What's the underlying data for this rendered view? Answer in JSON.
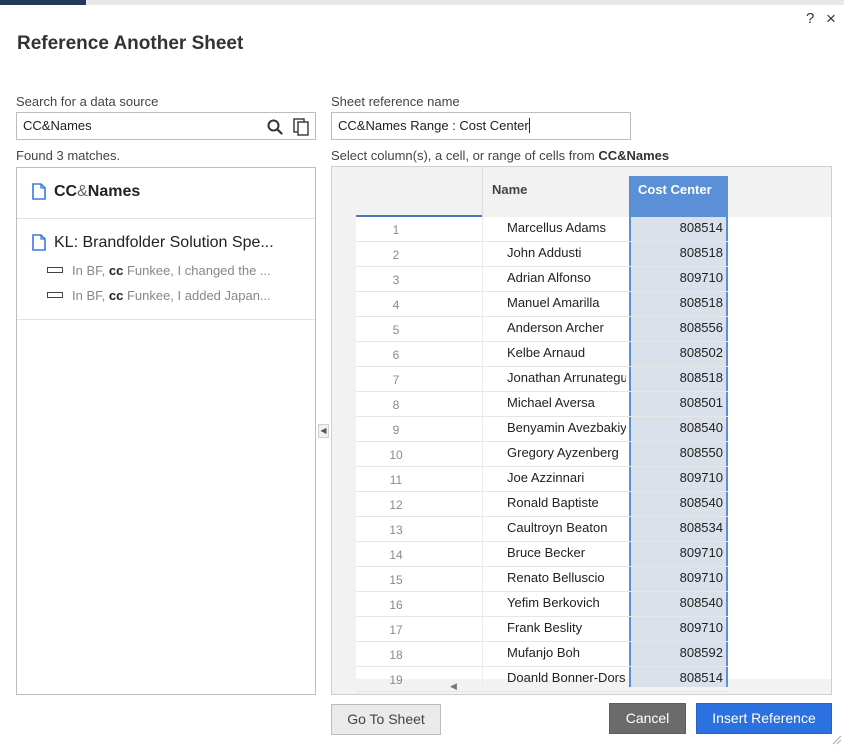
{
  "dialog": {
    "title": "Reference Another Sheet",
    "help_icon": "?",
    "close_icon": "×"
  },
  "search": {
    "label": "Search for a data source",
    "value": "CC&Names",
    "found_text": "Found 3 matches."
  },
  "reference": {
    "label": "Sheet reference name",
    "value": "CC&Names Range : Cost Center",
    "select_prefix": "Select column(s), a cell, or range of cells from ",
    "select_sheet": "CC&Names"
  },
  "results": [
    {
      "name_part1": "CC",
      "name_part2": "&",
      "name_part3": "Names",
      "comments": []
    },
    {
      "name": "KL: Brandfolder Solution Spe...",
      "comments": [
        {
          "prefix": "In BF, ",
          "highlight": "cc",
          "suffix": " Funkee, I changed the ..."
        },
        {
          "prefix": "In BF, ",
          "highlight": "cc",
          "suffix": " Funkee, I added Japan..."
        }
      ]
    }
  ],
  "grid": {
    "columns": {
      "name": "Name",
      "cost_center": "Cost Center"
    },
    "rows": [
      {
        "num": "1",
        "name": "Marcellus Adams",
        "cc": "808514"
      },
      {
        "num": "2",
        "name": "John Addusti",
        "cc": "808518"
      },
      {
        "num": "3",
        "name": "Adrian Alfonso",
        "cc": "809710"
      },
      {
        "num": "4",
        "name": "Manuel Amarilla",
        "cc": "808518"
      },
      {
        "num": "5",
        "name": "Anderson Archer",
        "cc": "808556"
      },
      {
        "num": "6",
        "name": "Kelbe Arnaud",
        "cc": "808502"
      },
      {
        "num": "7",
        "name": "Jonathan Arrunategui",
        "cc": "808518"
      },
      {
        "num": "8",
        "name": "Michael Aversa",
        "cc": "808501"
      },
      {
        "num": "9",
        "name": "Benyamin Avezbakiyev",
        "cc": "808540"
      },
      {
        "num": "10",
        "name": "Gregory Ayzenberg",
        "cc": "808550"
      },
      {
        "num": "11",
        "name": "Joe Azzinnari",
        "cc": "809710"
      },
      {
        "num": "12",
        "name": "Ronald Baptiste",
        "cc": "808540"
      },
      {
        "num": "13",
        "name": "Caultroyn Beaton",
        "cc": "808534"
      },
      {
        "num": "14",
        "name": "Bruce Becker",
        "cc": "809710"
      },
      {
        "num": "15",
        "name": "Renato Belluscio",
        "cc": "809710"
      },
      {
        "num": "16",
        "name": "Yefim Berkovich",
        "cc": "808540"
      },
      {
        "num": "17",
        "name": "Frank Beslity",
        "cc": "809710"
      },
      {
        "num": "18",
        "name": "Mufanjo Boh",
        "cc": "808592"
      },
      {
        "num": "19",
        "name": "Doanld Bonner-Dorsey",
        "cc": "808514"
      }
    ]
  },
  "buttons": {
    "go_to_sheet": "Go To Sheet",
    "cancel": "Cancel",
    "insert": "Insert Reference"
  },
  "colors": {
    "accent": "#2b72e0",
    "selected_header": "#5b8fd6",
    "selected_column": "#dbe1ea"
  }
}
